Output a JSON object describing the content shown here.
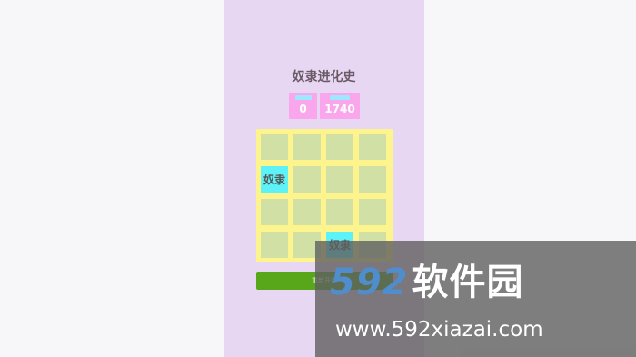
{
  "game": {
    "title": "奴隶进化史",
    "score_label": "score",
    "best_label": "best",
    "score": "0",
    "best": "1740",
    "tiles": [
      {
        "row": 1,
        "col": 0,
        "label": "奴隶"
      },
      {
        "row": 3,
        "col": 2,
        "label": "奴隶"
      }
    ],
    "restart_label": "重新开始"
  },
  "colors": {
    "page_bg": "#e8d7f3",
    "score_box": "#f9a6ec",
    "board_bg": "#fdf48d",
    "empty_cell": "#d1e0a4",
    "tile": "#5cf2f8",
    "button": "#58a71a"
  },
  "watermark": {
    "logo_num": "592",
    "logo_cn": "软件园",
    "url": "www.592xiazai.com"
  }
}
